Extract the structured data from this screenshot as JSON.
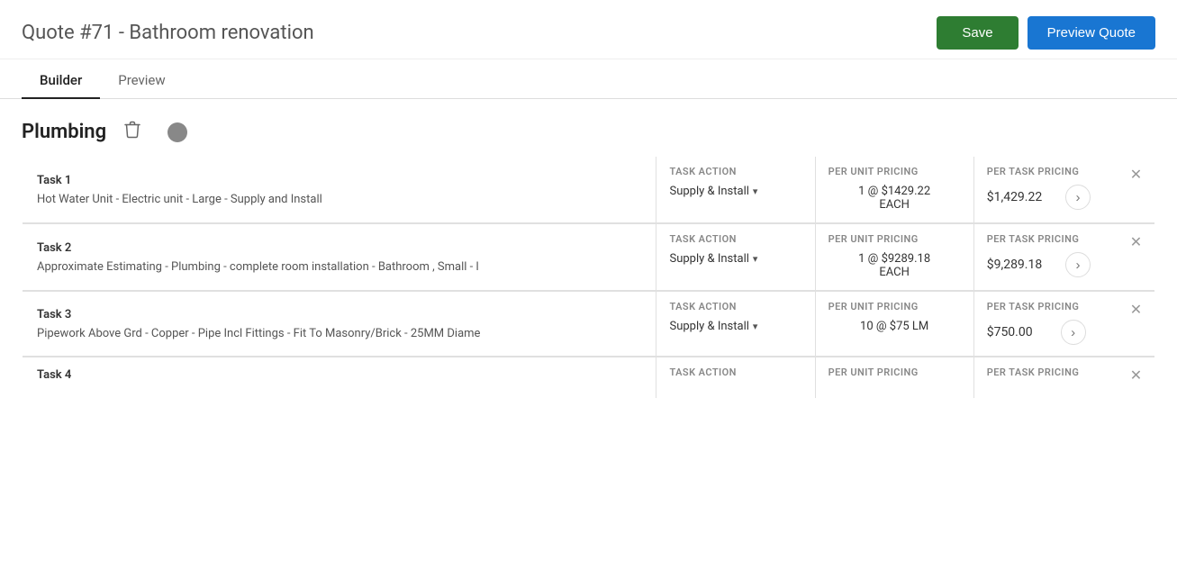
{
  "header": {
    "quote_number": "Quote #71",
    "separator": " - ",
    "quote_title": "Bathroom renovation",
    "save_label": "Save",
    "preview_label": "Preview Quote"
  },
  "tabs": [
    {
      "id": "builder",
      "label": "Builder",
      "active": true
    },
    {
      "id": "preview",
      "label": "Preview",
      "active": false
    }
  ],
  "section": {
    "title": "Plumbing",
    "delete_icon": "🗑"
  },
  "columns": {
    "task_action": "TASK ACTION",
    "per_unit_pricing": "PER UNIT PRICING",
    "per_task_pricing": "PER TASK PRICING"
  },
  "tasks": [
    {
      "label": "Task 1",
      "description": "Hot Water Unit - Electric unit - Large - Supply and Install",
      "action": "Supply & Install",
      "per_unit": "1 @ $1429.22",
      "per_unit_sub": "EACH",
      "per_task": "$1,429.22"
    },
    {
      "label": "Task 2",
      "description": "Approximate Estimating - Plumbing - complete room installation - Bathroom , Small - l",
      "action": "Supply & Install",
      "per_unit": "1 @ $9289.18",
      "per_unit_sub": "EACH",
      "per_task": "$9,289.18"
    },
    {
      "label": "Task 3",
      "description": "Pipework Above Grd - Copper - Pipe Incl Fittings - Fit To Masonry/Brick - 25MM Diame",
      "action": "Supply & Install",
      "per_unit": "10 @ $75 LM",
      "per_unit_sub": "",
      "per_task": "$750.00"
    },
    {
      "label": "Task 4",
      "description": "",
      "action": "",
      "per_unit": "",
      "per_unit_sub": "",
      "per_task": ""
    }
  ],
  "icons": {
    "delete": "🗑",
    "close": "✕",
    "chevron_right": "›",
    "dropdown_arrow": "▾"
  }
}
